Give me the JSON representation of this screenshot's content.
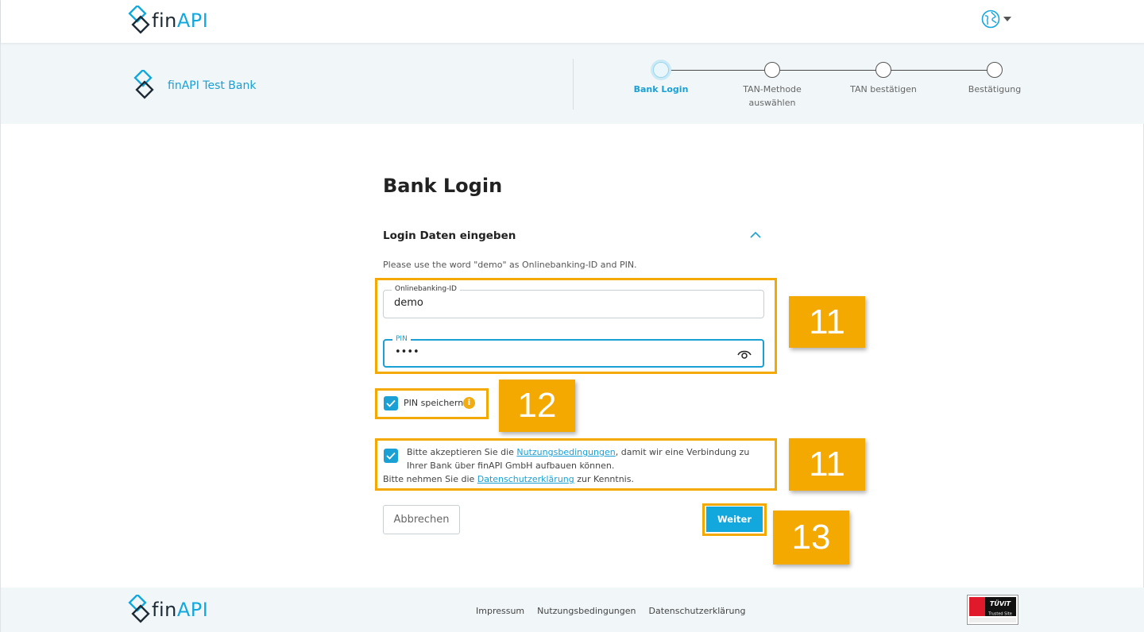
{
  "brand": {
    "fin": "fin",
    "api": "API",
    "accent": "#12a7dd"
  },
  "header": {
    "language_icon": "globe-icon"
  },
  "bank": {
    "name": "finAPI Test Bank"
  },
  "steps": [
    {
      "label": "Bank Login",
      "active": true
    },
    {
      "label": "TAN-Methode auswählen",
      "active": false
    },
    {
      "label": "TAN bestätigen",
      "active": false
    },
    {
      "label": "Bestätigung",
      "active": false
    }
  ],
  "form": {
    "title": "Bank Login",
    "section_title": "Login Daten eingeben",
    "hint": "Please use the word \"demo\" as Onlinebanking-ID and PIN.",
    "id_label": "Onlinebanking-ID",
    "id_value": "demo",
    "pin_label": "PIN",
    "pin_value": "demo",
    "save_pin_label": "PIN speichern",
    "save_pin_checked": true,
    "terms_checked": true,
    "terms_prefix": "Bitte akzeptieren Sie die ",
    "terms_link": "Nutzungsbedingungen",
    "terms_suffix": ", damit wir eine Verbindung zu Ihrer Bank über finAPI GmbH aufbauen können.",
    "privacy_prefix": "Bitte nehmen Sie die ",
    "privacy_link": "Datenschutzerklärung",
    "privacy_suffix": " zur Kenntnis.",
    "cancel_label": "Abbrechen",
    "next_label": "Weiter"
  },
  "annotations": {
    "a": "11",
    "b": "12",
    "c": "11",
    "d": "13",
    "color": "#f4a900"
  },
  "footer": {
    "links": [
      "Impressum",
      "Nutzungsbedingungen",
      "Datenschutzerklärung"
    ],
    "seal": "TÜViT Trusted Site"
  }
}
